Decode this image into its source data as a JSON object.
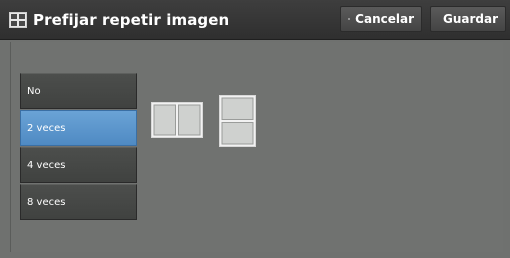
{
  "header": {
    "title": "Prefijar repetir imagen",
    "title_icon": "repeat-image-icon",
    "cancel_label": "Cancelar",
    "cancel_icon": "close-icon",
    "save_label": "Guardar",
    "save_icon": "checkmark-icon"
  },
  "options": [
    {
      "label": "No",
      "selected": false
    },
    {
      "label": "2 veces",
      "selected": true
    },
    {
      "label": "4 veces",
      "selected": false
    },
    {
      "label": "8 veces",
      "selected": false
    }
  ],
  "colors": {
    "selected": "#5b96cd",
    "header": "#363636",
    "background": "#6f716f"
  }
}
